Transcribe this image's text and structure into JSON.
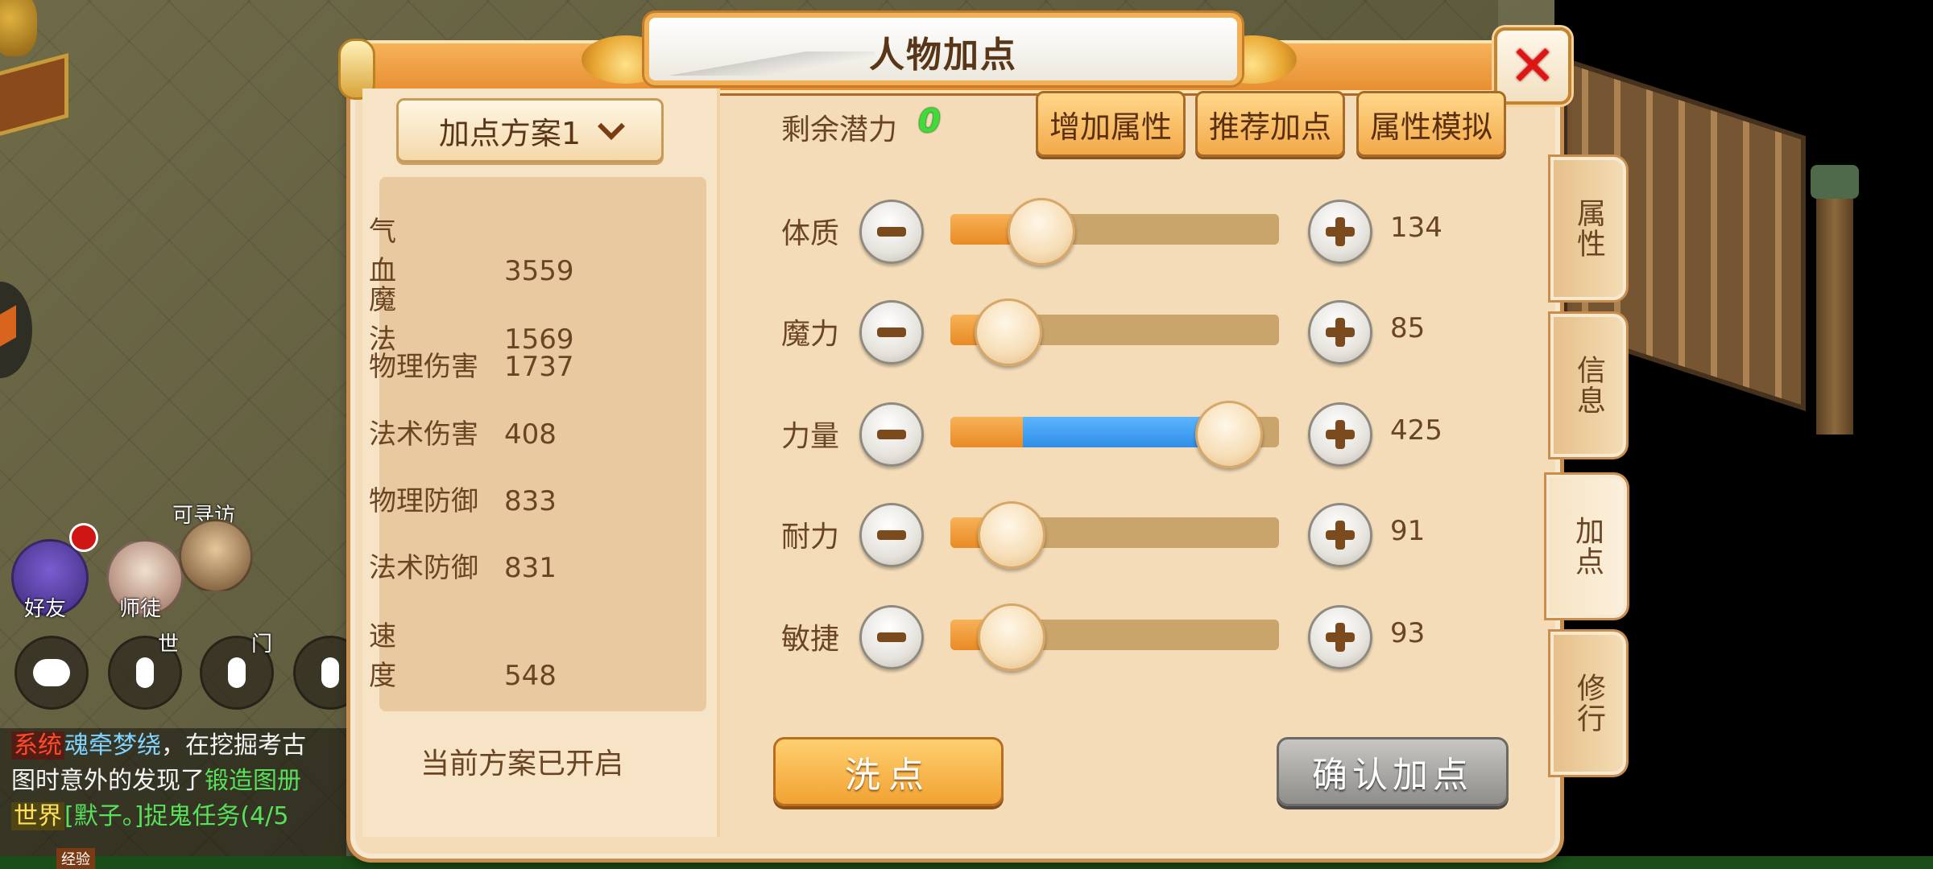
{
  "dialog": {
    "title": "人物加点",
    "plan_select": "加点方案1",
    "plan_status": "当前方案已开启"
  },
  "stats": [
    {
      "label": "气血",
      "value": "3559"
    },
    {
      "label": "魔法",
      "value": "1569"
    },
    {
      "label": "物理伤害",
      "value": "1737"
    },
    {
      "label": "法术伤害",
      "value": "408"
    },
    {
      "label": "物理防御",
      "value": "833"
    },
    {
      "label": "法术防御",
      "value": "831"
    },
    {
      "label": "速度",
      "value": "548"
    }
  ],
  "potential": {
    "label": "剩余潜力",
    "value": "0"
  },
  "top_buttons": {
    "add_attr": "增加属性",
    "recommend": "推荐加点",
    "simulate": "属性模拟"
  },
  "attributes": [
    {
      "label": "体质",
      "value": "134",
      "level": 0.27
    },
    {
      "label": "魔力",
      "value": "85",
      "level": 0.17
    },
    {
      "label": "力量",
      "value": "425",
      "level": 0.84,
      "pending_from": 0.22
    },
    {
      "label": "耐力",
      "value": "91",
      "level": 0.18
    },
    {
      "label": "敏捷",
      "value": "93",
      "level": 0.18
    }
  ],
  "buttons": {
    "wash": "洗点",
    "confirm": "确认加点"
  },
  "side_tabs": [
    "属性",
    "信息",
    "加点",
    "修行"
  ],
  "side_tab_active": "加点",
  "hud": {
    "friends": "好友",
    "mentor": "师徒",
    "visitable": "可寻访",
    "ch_world": "世",
    "ch_sect": "门"
  },
  "chat": [
    {
      "tag": "系统",
      "name": "魂牵梦绕",
      "text": "，在挖掘考古"
    },
    {
      "text": "图时意外的发现了",
      "item": "锻造图册"
    },
    {
      "tag": "世界",
      "name": "[默子。]",
      "text": "捉鬼任务(4/5"
    }
  ],
  "exp_tag": "经验",
  "colors": {
    "accent": "#f3a949",
    "frame": "#f4dcb8",
    "potential": "#3edb3a",
    "slider_fill": "#e98a25",
    "slider_pending": "#2f8ee6"
  }
}
